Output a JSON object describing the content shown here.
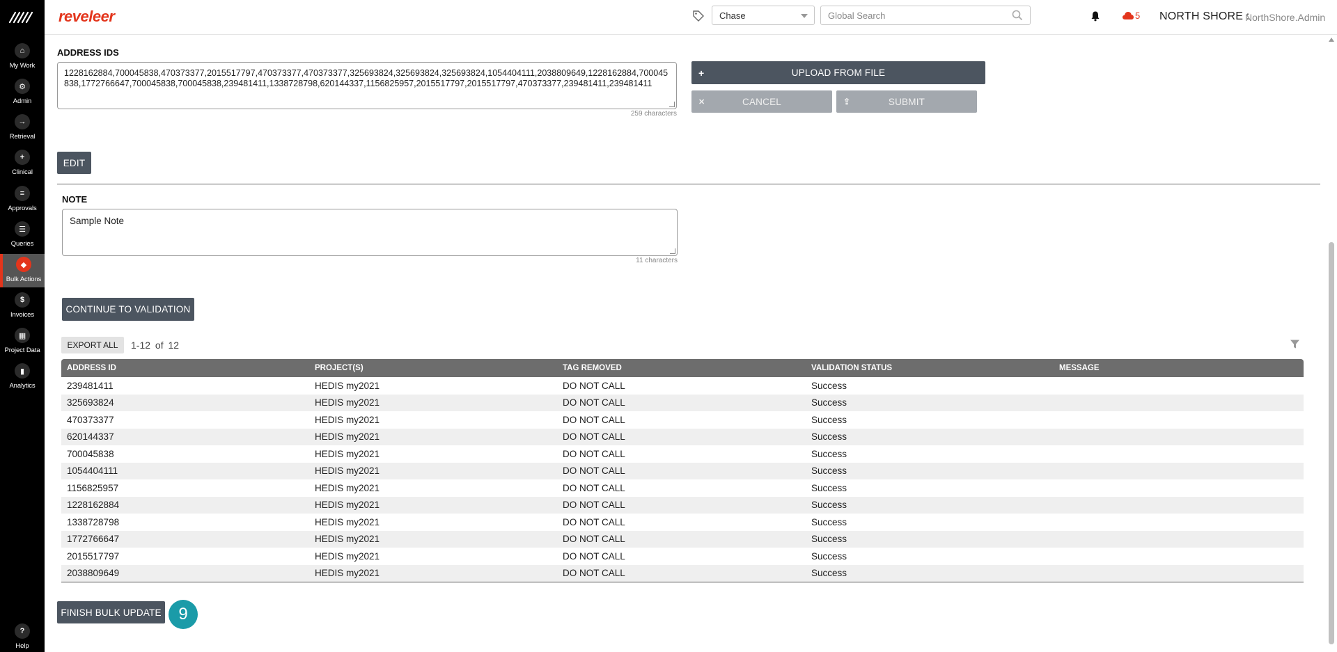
{
  "app": {
    "brand": "reveleer"
  },
  "sidebar": {
    "items": [
      {
        "label": "My Work",
        "glyph": "⌂"
      },
      {
        "label": "Admin",
        "glyph": "⚙"
      },
      {
        "label": "Retrieval",
        "glyph": "→"
      },
      {
        "label": "Clinical",
        "glyph": "+"
      },
      {
        "label": "Approvals",
        "glyph": "≡"
      },
      {
        "label": "Queries",
        "glyph": "☰"
      },
      {
        "label": "Bulk Actions",
        "glyph": "◆"
      },
      {
        "label": "Invoices",
        "glyph": "$"
      },
      {
        "label": "Project Data",
        "glyph": "▦"
      },
      {
        "label": "Analytics",
        "glyph": "▮"
      }
    ],
    "help": {
      "label": "Help",
      "glyph": "?"
    }
  },
  "topbar": {
    "project_select": "Chase",
    "search_placeholder": "Global Search",
    "cloud_count": "5",
    "org": "NORTH SHORE :",
    "user": "NorthShore.Admin"
  },
  "address_ids": {
    "label": "ADDRESS IDS",
    "value": "1228162884,700045838,470373377,2015517797,470373377,470373377,325693824,325693824,325693824,1054404111,2038809649,1228162884,700045838,1772766647,700045838,700045838,239481411,1338728798,620144337,1156825957,2015517797,2015517797,470373377,239481411,239481411",
    "char_count": "259 characters",
    "upload_label": "UPLOAD FROM FILE",
    "cancel_label": "CANCEL",
    "submit_label": "SUBMIT",
    "edit_label": "EDIT"
  },
  "note": {
    "label": "NOTE",
    "value": "Sample Note",
    "char_count": "11 characters",
    "continue_label": "CONTINUE TO VALIDATION"
  },
  "results": {
    "export_label": "EXPORT ALL",
    "pager": "1-12 of 12",
    "columns": [
      "ADDRESS ID",
      "PROJECT(S)",
      "TAG REMOVED",
      "VALIDATION STATUS",
      "MESSAGE"
    ],
    "rows": [
      [
        "239481411",
        "HEDIS my2021",
        "DO NOT CALL",
        "Success",
        ""
      ],
      [
        "325693824",
        "HEDIS my2021",
        "DO NOT CALL",
        "Success",
        ""
      ],
      [
        "470373377",
        "HEDIS my2021",
        "DO NOT CALL",
        "Success",
        ""
      ],
      [
        "620144337",
        "HEDIS my2021",
        "DO NOT CALL",
        "Success",
        ""
      ],
      [
        "700045838",
        "HEDIS my2021",
        "DO NOT CALL",
        "Success",
        ""
      ],
      [
        "1054404111",
        "HEDIS my2021",
        "DO NOT CALL",
        "Success",
        ""
      ],
      [
        "1156825957",
        "HEDIS my2021",
        "DO NOT CALL",
        "Success",
        ""
      ],
      [
        "1228162884",
        "HEDIS my2021",
        "DO NOT CALL",
        "Success",
        ""
      ],
      [
        "1338728798",
        "HEDIS my2021",
        "DO NOT CALL",
        "Success",
        ""
      ],
      [
        "1772766647",
        "HEDIS my2021",
        "DO NOT CALL",
        "Success",
        ""
      ],
      [
        "2015517797",
        "HEDIS my2021",
        "DO NOT CALL",
        "Success",
        ""
      ],
      [
        "2038809649",
        "HEDIS my2021",
        "DO NOT CALL",
        "Success",
        ""
      ]
    ],
    "finish_label": "FINISH BULK UPDATE",
    "step_badge": "9"
  },
  "colors": {
    "accent": "#e3351c",
    "button_dark": "#4c5560",
    "button_disabled": "#a3a8ae",
    "badge": "#1a9ba8"
  }
}
